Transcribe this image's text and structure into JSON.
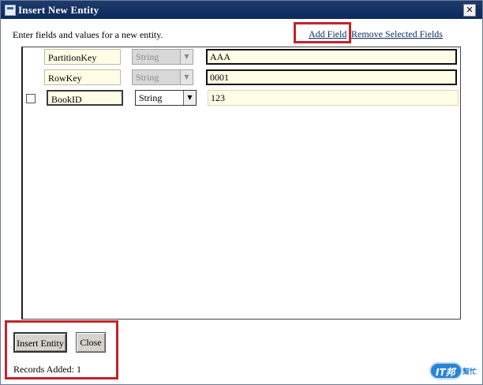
{
  "window": {
    "title": "Insert New Entity",
    "close_glyph": "✕"
  },
  "instructions": "Enter fields and values for a new entity.",
  "links": {
    "add_field": "Add Field",
    "remove_selected": "Remove Selected Fields"
  },
  "fields": [
    {
      "key": "PartitionKey",
      "type": "String",
      "value": "AAA",
      "has_checkbox": false,
      "type_editable": false
    },
    {
      "key": "RowKey",
      "type": "String",
      "value": "0001",
      "has_checkbox": false,
      "type_editable": false
    },
    {
      "key": "BookID",
      "type": "String",
      "value": "123",
      "has_checkbox": true,
      "type_editable": true
    }
  ],
  "buttons": {
    "insert_entity": "Insert Entity",
    "close": "Close"
  },
  "status": {
    "records_added": "Records Added: 1"
  },
  "logo": {
    "text": "IT邦",
    "sub": "幫忙"
  },
  "colors": {
    "titlebar": "#0b2a5e",
    "highlight": "#c0242d",
    "field_bg": "#fffde6",
    "link": "#0b2a5e"
  }
}
